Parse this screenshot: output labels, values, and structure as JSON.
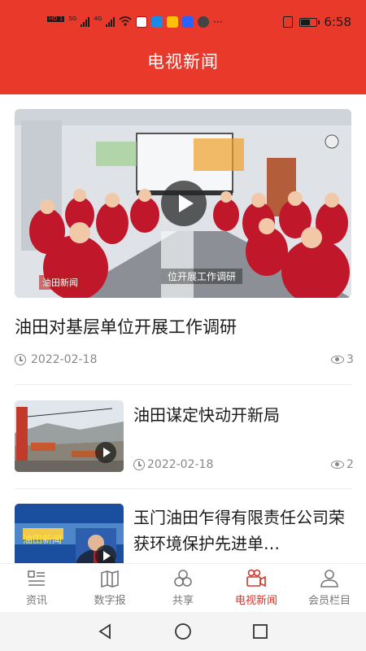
{
  "status_bar": {
    "time": "6:58",
    "left_tags": [
      "HD 1",
      "HD 2",
      "5G",
      "4G"
    ],
    "icons": [
      "signal-icon",
      "wifi-icon",
      "app-notification-icons",
      "more-icon",
      "vibrate-icon",
      "battery-icon"
    ]
  },
  "header": {
    "title": "电视新闻"
  },
  "hero": {
    "caption": "位开展工作调研",
    "logo_tag": "油田新闻",
    "title": "油田对基层单位开展工作调研",
    "date": "2022-02-18",
    "views": "3"
  },
  "items": [
    {
      "title": "油田谋定快动开新局",
      "date": "2022-02-18",
      "views": "2"
    },
    {
      "title": "玉门油田乍得有限责任公司荣获环境保护先进单…",
      "thumb_label": "油田新闻"
    }
  ],
  "bottom_nav": [
    {
      "label": "资讯",
      "icon": "list-icon",
      "active": false
    },
    {
      "label": "数字报",
      "icon": "book-icon",
      "active": false
    },
    {
      "label": "共享",
      "icon": "share-circles-icon",
      "active": false
    },
    {
      "label": "电视新闻",
      "icon": "video-camera-icon",
      "active": true
    },
    {
      "label": "会员栏目",
      "icon": "user-icon",
      "active": false
    }
  ],
  "colors": {
    "brand": "#e8392b",
    "active_tab": "#d2362a",
    "meta_text": "#888888"
  }
}
